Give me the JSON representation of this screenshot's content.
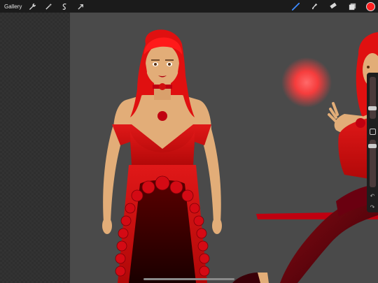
{
  "toolbar": {
    "gallery_label": "Gallery",
    "left_tools": [
      "wrench-icon",
      "magic-wand-icon",
      "selection-icon",
      "transform-arrow-icon"
    ],
    "right_tools": [
      "brush-icon",
      "smudge-icon",
      "eraser-icon",
      "layers-icon"
    ],
    "active_color": "#ff2020",
    "accent": "#3d8bff"
  },
  "canvas": {
    "background": "#4a4a4a",
    "glow_color": "#ff4a4a"
  },
  "sidebar": {
    "undo_icon": "undo-icon",
    "redo_icon": "redo-icon"
  }
}
